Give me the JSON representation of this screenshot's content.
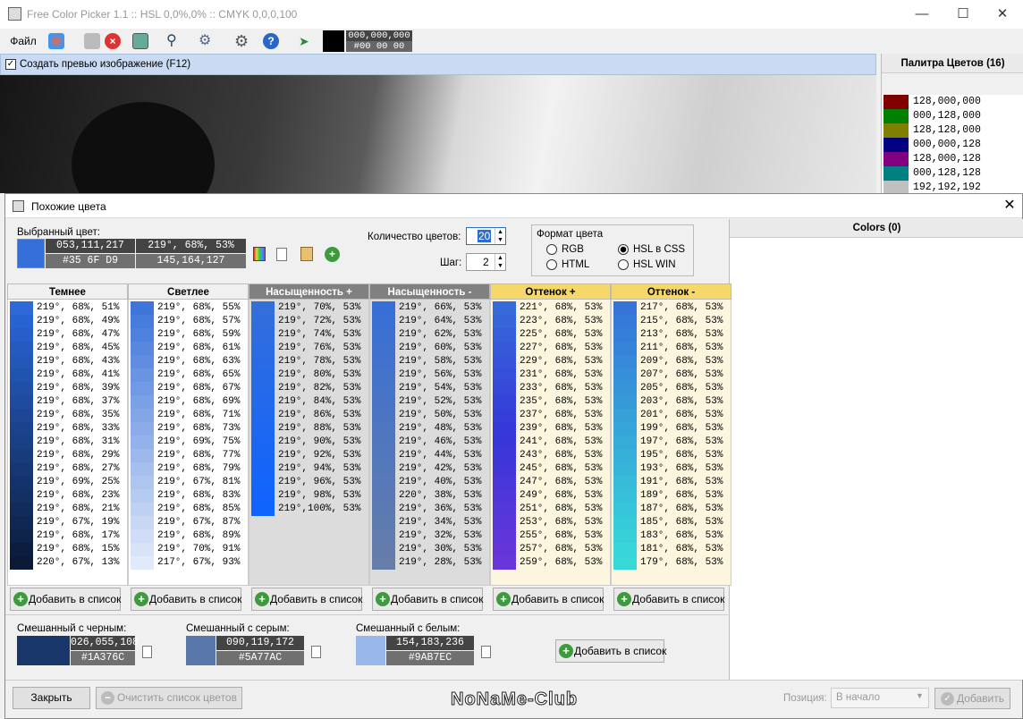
{
  "window": {
    "title": "Free Color Picker 1.1  ::  HSL 0,0%,0%  ::  CMYK 0,0,0,100"
  },
  "toolbar": {
    "file_menu": "Файл",
    "color_rgb": "000,000,000",
    "color_hex": "#00 00 00"
  },
  "preview": {
    "checkbox_label": "Создать превью изображение (F12)"
  },
  "palette": {
    "title": "Палитра Цветов (16)",
    "items": [
      {
        "color": "#800000",
        "label": "128,000,000"
      },
      {
        "color": "#008000",
        "label": "000,128,000"
      },
      {
        "color": "#808000",
        "label": "128,128,000"
      },
      {
        "color": "#000080",
        "label": "000,000,128"
      },
      {
        "color": "#800080",
        "label": "128,000,128"
      },
      {
        "color": "#008080",
        "label": "000,128,128"
      },
      {
        "color": "#c0c0c0",
        "label": "192,192,192"
      }
    ]
  },
  "dialog": {
    "title": "Похожие цвета",
    "selected_label": "Выбранный цвет:",
    "selected_rgb": "053,111,217",
    "selected_hsl": "219°, 68%, 53%",
    "selected_hex": "#35 6F D9",
    "selected_complement": "145,164,127",
    "selected_color": "#356fd9",
    "count_label": "Количество цветов:",
    "count_value": "20",
    "step_label": "Шаг:",
    "step_value": "2",
    "format_title": "Формат цвета",
    "format_rgb": "RGB",
    "format_html": "HTML",
    "format_hslcss": "HSL в CSS",
    "format_hslwin": "HSL WIN",
    "colors_panel_title": "Colors (0)",
    "add_to_list": "Добавить в список",
    "mix_black_label": "Смешанный с черным:",
    "mix_black_rgb": "026,055,108",
    "mix_black_hex": "#1A376C",
    "mix_black_color": "#1a376c",
    "mix_gray_label": "Смешанный с серым:",
    "mix_gray_rgb": "090,119,172",
    "mix_gray_hex": "#5A77AC",
    "mix_gray_color": "#5a77ac",
    "mix_white_label": "Смешанный с белым:",
    "mix_white_rgb": "154,183,236",
    "mix_white_hex": "#9AB7EC",
    "mix_white_color": "#9ab7ec",
    "close_button": "Закрыть",
    "clear_button": "Очистить список цветов",
    "position_label": "Позиция:",
    "position_value": "В начало",
    "add_button": "Добавить",
    "watermark": "NoNaMe-Club"
  },
  "columns": [
    {
      "title": "Темнее",
      "head_bg": "#f0f0f0",
      "head_color": "#000",
      "body_bg": "#ffffff",
      "items": [
        {
          "hsl": "219°, 68%, 51%",
          "c": "hsl(219,68%,51%)"
        },
        {
          "hsl": "219°, 68%, 49%",
          "c": "hsl(219,68%,49%)"
        },
        {
          "hsl": "219°, 68%, 47%",
          "c": "hsl(219,68%,47%)"
        },
        {
          "hsl": "219°, 68%, 45%",
          "c": "hsl(219,68%,45%)"
        },
        {
          "hsl": "219°, 68%, 43%",
          "c": "hsl(219,68%,43%)"
        },
        {
          "hsl": "219°, 68%, 41%",
          "c": "hsl(219,68%,41%)"
        },
        {
          "hsl": "219°, 68%, 39%",
          "c": "hsl(219,68%,39%)"
        },
        {
          "hsl": "219°, 68%, 37%",
          "c": "hsl(219,68%,37%)"
        },
        {
          "hsl": "219°, 68%, 35%",
          "c": "hsl(219,68%,35%)"
        },
        {
          "hsl": "219°, 68%, 33%",
          "c": "hsl(219,68%,33%)"
        },
        {
          "hsl": "219°, 68%, 31%",
          "c": "hsl(219,68%,31%)"
        },
        {
          "hsl": "219°, 68%, 29%",
          "c": "hsl(219,68%,29%)"
        },
        {
          "hsl": "219°, 68%, 27%",
          "c": "hsl(219,68%,27%)"
        },
        {
          "hsl": "219°, 69%, 25%",
          "c": "hsl(219,69%,25%)"
        },
        {
          "hsl": "219°, 68%, 23%",
          "c": "hsl(219,68%,23%)"
        },
        {
          "hsl": "219°, 68%, 21%",
          "c": "hsl(219,68%,21%)"
        },
        {
          "hsl": "219°, 67%, 19%",
          "c": "hsl(219,67%,19%)"
        },
        {
          "hsl": "219°, 68%, 17%",
          "c": "hsl(219,68%,17%)"
        },
        {
          "hsl": "219°, 68%, 15%",
          "c": "hsl(219,68%,15%)"
        },
        {
          "hsl": "220°, 67%, 13%",
          "c": "hsl(220,67%,13%)"
        }
      ]
    },
    {
      "title": "Светлее",
      "head_bg": "#f0f0f0",
      "head_color": "#000",
      "body_bg": "#ffffff",
      "items": [
        {
          "hsl": "219°, 68%, 55%",
          "c": "hsl(219,68%,55%)"
        },
        {
          "hsl": "219°, 68%, 57%",
          "c": "hsl(219,68%,57%)"
        },
        {
          "hsl": "219°, 68%, 59%",
          "c": "hsl(219,68%,59%)"
        },
        {
          "hsl": "219°, 68%, 61%",
          "c": "hsl(219,68%,61%)"
        },
        {
          "hsl": "219°, 68%, 63%",
          "c": "hsl(219,68%,63%)"
        },
        {
          "hsl": "219°, 68%, 65%",
          "c": "hsl(219,68%,65%)"
        },
        {
          "hsl": "219°, 68%, 67%",
          "c": "hsl(219,68%,67%)"
        },
        {
          "hsl": "219°, 68%, 69%",
          "c": "hsl(219,68%,69%)"
        },
        {
          "hsl": "219°, 68%, 71%",
          "c": "hsl(219,68%,71%)"
        },
        {
          "hsl": "219°, 68%, 73%",
          "c": "hsl(219,68%,73%)"
        },
        {
          "hsl": "219°, 69%, 75%",
          "c": "hsl(219,69%,75%)"
        },
        {
          "hsl": "219°, 68%, 77%",
          "c": "hsl(219,68%,77%)"
        },
        {
          "hsl": "219°, 68%, 79%",
          "c": "hsl(219,68%,79%)"
        },
        {
          "hsl": "219°, 67%, 81%",
          "c": "hsl(219,67%,81%)"
        },
        {
          "hsl": "219°, 68%, 83%",
          "c": "hsl(219,68%,83%)"
        },
        {
          "hsl": "219°, 68%, 85%",
          "c": "hsl(219,68%,85%)"
        },
        {
          "hsl": "219°, 67%, 87%",
          "c": "hsl(219,67%,87%)"
        },
        {
          "hsl": "219°, 68%, 89%",
          "c": "hsl(219,68%,89%)"
        },
        {
          "hsl": "219°, 70%, 91%",
          "c": "hsl(219,70%,91%)"
        },
        {
          "hsl": "217°, 67%, 93%",
          "c": "hsl(217,67%,93%)"
        }
      ]
    },
    {
      "title": "Насыщенность +",
      "head_bg": "#808080",
      "head_color": "#fff",
      "body_bg": "#dcdcdc",
      "items": [
        {
          "hsl": "219°, 70%, 53%",
          "c": "hsl(219,70%,53%)"
        },
        {
          "hsl": "219°, 72%, 53%",
          "c": "hsl(219,72%,53%)"
        },
        {
          "hsl": "219°, 74%, 53%",
          "c": "hsl(219,74%,53%)"
        },
        {
          "hsl": "219°, 76%, 53%",
          "c": "hsl(219,76%,53%)"
        },
        {
          "hsl": "219°, 78%, 53%",
          "c": "hsl(219,78%,53%)"
        },
        {
          "hsl": "219°, 80%, 53%",
          "c": "hsl(219,80%,53%)"
        },
        {
          "hsl": "219°, 82%, 53%",
          "c": "hsl(219,82%,53%)"
        },
        {
          "hsl": "219°, 84%, 53%",
          "c": "hsl(219,84%,53%)"
        },
        {
          "hsl": "219°, 86%, 53%",
          "c": "hsl(219,86%,53%)"
        },
        {
          "hsl": "219°, 88%, 53%",
          "c": "hsl(219,88%,53%)"
        },
        {
          "hsl": "219°, 90%, 53%",
          "c": "hsl(219,90%,53%)"
        },
        {
          "hsl": "219°, 92%, 53%",
          "c": "hsl(219,92%,53%)"
        },
        {
          "hsl": "219°, 94%, 53%",
          "c": "hsl(219,94%,53%)"
        },
        {
          "hsl": "219°, 96%, 53%",
          "c": "hsl(219,96%,53%)"
        },
        {
          "hsl": "219°, 98%, 53%",
          "c": "hsl(219,98%,53%)"
        },
        {
          "hsl": "219°,100%, 53%",
          "c": "hsl(219,100%,53%)"
        }
      ]
    },
    {
      "title": "Насыщенность -",
      "head_bg": "#808080",
      "head_color": "#fff",
      "body_bg": "#dcdcdc",
      "items": [
        {
          "hsl": "219°, 66%, 53%",
          "c": "hsl(219,66%,53%)"
        },
        {
          "hsl": "219°, 64%, 53%",
          "c": "hsl(219,64%,53%)"
        },
        {
          "hsl": "219°, 62%, 53%",
          "c": "hsl(219,62%,53%)"
        },
        {
          "hsl": "219°, 60%, 53%",
          "c": "hsl(219,60%,53%)"
        },
        {
          "hsl": "219°, 58%, 53%",
          "c": "hsl(219,58%,53%)"
        },
        {
          "hsl": "219°, 56%, 53%",
          "c": "hsl(219,56%,53%)"
        },
        {
          "hsl": "219°, 54%, 53%",
          "c": "hsl(219,54%,53%)"
        },
        {
          "hsl": "219°, 52%, 53%",
          "c": "hsl(219,52%,53%)"
        },
        {
          "hsl": "219°, 50%, 53%",
          "c": "hsl(219,50%,53%)"
        },
        {
          "hsl": "219°, 48%, 53%",
          "c": "hsl(219,48%,53%)"
        },
        {
          "hsl": "219°, 46%, 53%",
          "c": "hsl(219,46%,53%)"
        },
        {
          "hsl": "219°, 44%, 53%",
          "c": "hsl(219,44%,53%)"
        },
        {
          "hsl": "219°, 42%, 53%",
          "c": "hsl(219,42%,53%)"
        },
        {
          "hsl": "219°, 40%, 53%",
          "c": "hsl(219,40%,53%)"
        },
        {
          "hsl": "220°, 38%, 53%",
          "c": "hsl(220,38%,53%)"
        },
        {
          "hsl": "219°, 36%, 53%",
          "c": "hsl(219,36%,53%)"
        },
        {
          "hsl": "219°, 34%, 53%",
          "c": "hsl(219,34%,53%)"
        },
        {
          "hsl": "219°, 32%, 53%",
          "c": "hsl(219,32%,53%)"
        },
        {
          "hsl": "219°, 30%, 53%",
          "c": "hsl(219,30%,53%)"
        },
        {
          "hsl": "219°, 28%, 53%",
          "c": "hsl(219,28%,53%)"
        }
      ]
    },
    {
      "title": "Оттенок +",
      "head_bg": "#f5d76a",
      "head_color": "#000",
      "body_bg": "#fbf6dd",
      "items": [
        {
          "hsl": "221°, 68%, 53%",
          "c": "hsl(221,68%,53%)"
        },
        {
          "hsl": "223°, 68%, 53%",
          "c": "hsl(223,68%,53%)"
        },
        {
          "hsl": "225°, 68%, 53%",
          "c": "hsl(225,68%,53%)"
        },
        {
          "hsl": "227°, 68%, 53%",
          "c": "hsl(227,68%,53%)"
        },
        {
          "hsl": "229°, 68%, 53%",
          "c": "hsl(229,68%,53%)"
        },
        {
          "hsl": "231°, 68%, 53%",
          "c": "hsl(231,68%,53%)"
        },
        {
          "hsl": "233°, 68%, 53%",
          "c": "hsl(233,68%,53%)"
        },
        {
          "hsl": "235°, 68%, 53%",
          "c": "hsl(235,68%,53%)"
        },
        {
          "hsl": "237°, 68%, 53%",
          "c": "hsl(237,68%,53%)"
        },
        {
          "hsl": "239°, 68%, 53%",
          "c": "hsl(239,68%,53%)"
        },
        {
          "hsl": "241°, 68%, 53%",
          "c": "hsl(241,68%,53%)"
        },
        {
          "hsl": "243°, 68%, 53%",
          "c": "hsl(243,68%,53%)"
        },
        {
          "hsl": "245°, 68%, 53%",
          "c": "hsl(245,68%,53%)"
        },
        {
          "hsl": "247°, 68%, 53%",
          "c": "hsl(247,68%,53%)"
        },
        {
          "hsl": "249°, 68%, 53%",
          "c": "hsl(249,68%,53%)"
        },
        {
          "hsl": "251°, 68%, 53%",
          "c": "hsl(251,68%,53%)"
        },
        {
          "hsl": "253°, 68%, 53%",
          "c": "hsl(253,68%,53%)"
        },
        {
          "hsl": "255°, 68%, 53%",
          "c": "hsl(255,68%,53%)"
        },
        {
          "hsl": "257°, 68%, 53%",
          "c": "hsl(257,68%,53%)"
        },
        {
          "hsl": "259°, 68%, 53%",
          "c": "hsl(259,68%,53%)"
        }
      ]
    },
    {
      "title": "Оттенок -",
      "head_bg": "#f5d76a",
      "head_color": "#000",
      "body_bg": "#fbf6dd",
      "items": [
        {
          "hsl": "217°, 68%, 53%",
          "c": "hsl(217,68%,53%)"
        },
        {
          "hsl": "215°, 68%, 53%",
          "c": "hsl(215,68%,53%)"
        },
        {
          "hsl": "213°, 68%, 53%",
          "c": "hsl(213,68%,53%)"
        },
        {
          "hsl": "211°, 68%, 53%",
          "c": "hsl(211,68%,53%)"
        },
        {
          "hsl": "209°, 68%, 53%",
          "c": "hsl(209,68%,53%)"
        },
        {
          "hsl": "207°, 68%, 53%",
          "c": "hsl(207,68%,53%)"
        },
        {
          "hsl": "205°, 68%, 53%",
          "c": "hsl(205,68%,53%)"
        },
        {
          "hsl": "203°, 68%, 53%",
          "c": "hsl(203,68%,53%)"
        },
        {
          "hsl": "201°, 68%, 53%",
          "c": "hsl(201,68%,53%)"
        },
        {
          "hsl": "199°, 68%, 53%",
          "c": "hsl(199,68%,53%)"
        },
        {
          "hsl": "197°, 68%, 53%",
          "c": "hsl(197,68%,53%)"
        },
        {
          "hsl": "195°, 68%, 53%",
          "c": "hsl(195,68%,53%)"
        },
        {
          "hsl": "193°, 68%, 53%",
          "c": "hsl(193,68%,53%)"
        },
        {
          "hsl": "191°, 68%, 53%",
          "c": "hsl(191,68%,53%)"
        },
        {
          "hsl": "189°, 68%, 53%",
          "c": "hsl(189,68%,53%)"
        },
        {
          "hsl": "187°, 68%, 53%",
          "c": "hsl(187,68%,53%)"
        },
        {
          "hsl": "185°, 68%, 53%",
          "c": "hsl(185,68%,53%)"
        },
        {
          "hsl": "183°, 68%, 53%",
          "c": "hsl(183,68%,53%)"
        },
        {
          "hsl": "181°, 68%, 53%",
          "c": "hsl(181,68%,53%)"
        },
        {
          "hsl": "179°, 68%, 53%",
          "c": "hsl(179,68%,53%)"
        }
      ]
    }
  ]
}
